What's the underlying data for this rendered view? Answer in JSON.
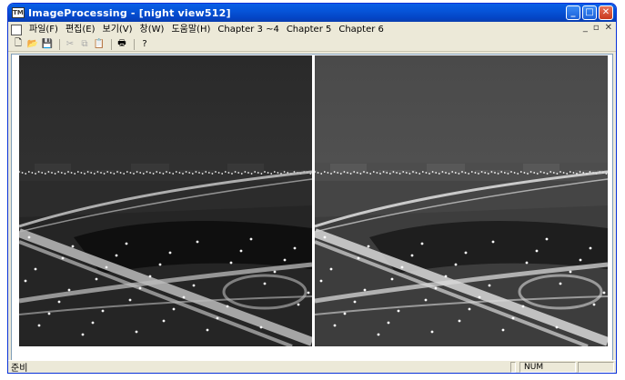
{
  "window": {
    "title": "ImageProcessing - [night view512]",
    "app_icon_label": "TM"
  },
  "menu": {
    "items": [
      {
        "label": "파일(F)",
        "name": "menu-file"
      },
      {
        "label": "편집(E)",
        "name": "menu-edit"
      },
      {
        "label": "보기(V)",
        "name": "menu-view"
      },
      {
        "label": "창(W)",
        "name": "menu-window"
      },
      {
        "label": "도움말(H)",
        "name": "menu-help"
      },
      {
        "label": "Chapter 3 ~4",
        "name": "menu-chapter-3-4"
      },
      {
        "label": "Chapter 5",
        "name": "menu-chapter-5"
      },
      {
        "label": "Chapter 6",
        "name": "menu-chapter-6"
      }
    ]
  },
  "toolbar": {
    "buttons": [
      {
        "name": "new-document-icon",
        "glyph": "🗋",
        "enabled": true
      },
      {
        "name": "open-folder-icon",
        "glyph": "📂",
        "enabled": true
      },
      {
        "name": "save-icon",
        "glyph": "💾",
        "enabled": true
      },
      {
        "name": "cut-icon",
        "glyph": "✂",
        "enabled": false
      },
      {
        "name": "copy-icon",
        "glyph": "⧉",
        "enabled": false
      },
      {
        "name": "paste-icon",
        "glyph": "📋",
        "enabled": false
      },
      {
        "name": "print-icon",
        "glyph": "🖶",
        "enabled": true
      },
      {
        "name": "help-icon",
        "glyph": "?",
        "enabled": true
      }
    ]
  },
  "images": {
    "left": {
      "name": "original-night-view-image",
      "tone": "dark"
    },
    "right": {
      "name": "processed-night-view-image",
      "tone": "bright"
    }
  },
  "status": {
    "text": "준비",
    "num_indicator": "NUM"
  }
}
